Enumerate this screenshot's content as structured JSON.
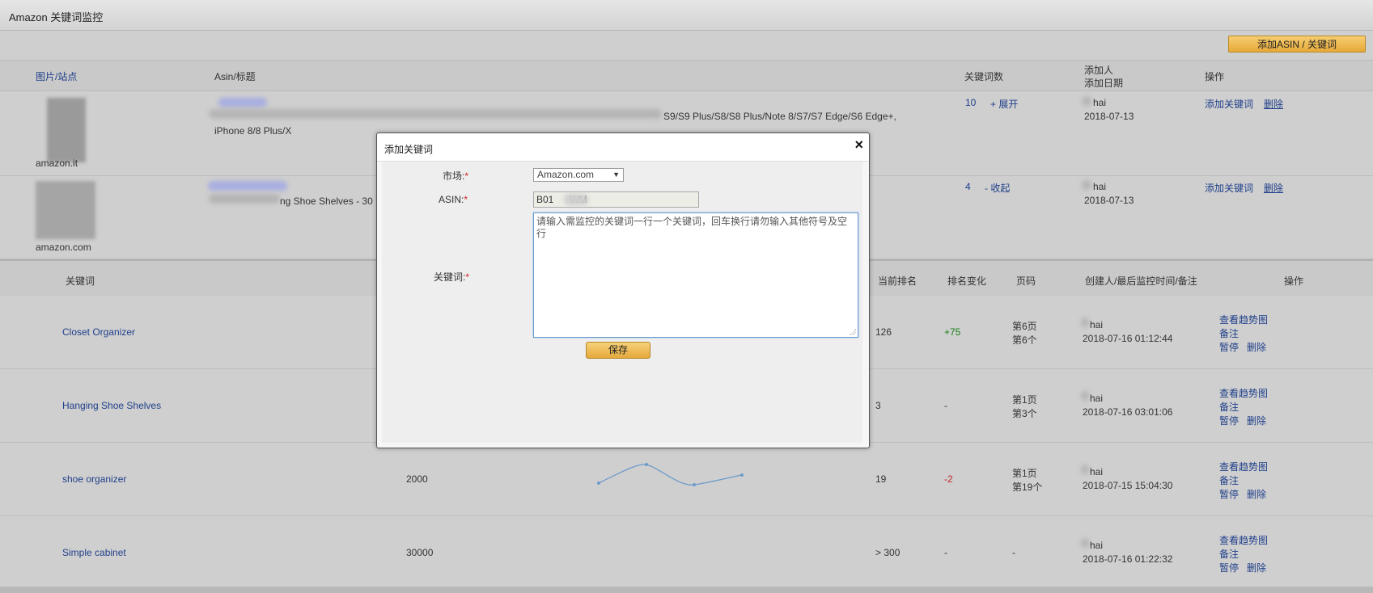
{
  "title": "Amazon 关键词监控",
  "toolbar": {
    "add_button": "添加ASIN / 关键词"
  },
  "product_table": {
    "headers": {
      "image_site": "图片/站点",
      "asin_title": "Asin/标题",
      "keyword_count": "关键词数",
      "added_by": "添加人",
      "added_date": "添加日期",
      "actions": "操作"
    },
    "rows": [
      {
        "site": "amazon.it",
        "title_end": "S9/S9 Plus/S8/S8 Plus/Note 8/S7/S7 Edge/S6 Edge+,",
        "title_line2": "iPhone 8/8 Plus/X",
        "count": "10",
        "toggle": "+ 展开",
        "user": "hai",
        "date": "2018-07-13",
        "add_kw": "添加关键词",
        "delete": "删除"
      },
      {
        "site": "amazon.com",
        "title_end": "ng Shoe Shelves - 30",
        "count": "4",
        "toggle": "- 收起",
        "user": "hai",
        "date": "2018-07-13",
        "add_kw": "添加关键词",
        "delete": "删除"
      }
    ]
  },
  "keyword_table": {
    "headers": {
      "keyword": "关键词",
      "current_rank": "当前排名",
      "rank_change": "排名变化",
      "page": "页码",
      "creator": "创建人/最后监控时间/备注",
      "actions": "操作"
    },
    "rows": [
      {
        "keyword": "Closet Organizer",
        "volume": "",
        "rank": "126",
        "change": "+75",
        "change_color": "#1a7f1a",
        "page1": "第6页",
        "page2": "第6个",
        "user": "hai",
        "time": "2018-07-16 01:12:44",
        "a_trend": "查看趋势图",
        "a_note": "备注",
        "a_pause": "暂停",
        "a_delete": "删除"
      },
      {
        "keyword": "Hanging Shoe Shelves",
        "volume": "",
        "rank": "3",
        "change": "-",
        "change_color": "#333333",
        "page1": "第1页",
        "page2": "第3个",
        "user": "hai",
        "time": "2018-07-16 03:01:06",
        "a_trend": "查看趋势图",
        "a_note": "备注",
        "a_pause": "暂停",
        "a_delete": "删除"
      },
      {
        "keyword": "shoe organizer",
        "volume": "2000",
        "rank": "19",
        "change": "-2",
        "change_color": "#c0262c",
        "page1": "第1页",
        "page2": "第19个",
        "user": "hai",
        "time": "2018-07-15 15:04:30",
        "a_trend": "查看趋势图",
        "a_note": "备注",
        "a_pause": "暂停",
        "a_delete": "删除"
      },
      {
        "keyword": "Simple cabinet",
        "volume": "30000",
        "rank": "> 300",
        "change": "-",
        "change_color": "#333333",
        "page1": "-",
        "page2": "",
        "user": "hai",
        "time": "2018-07-16 01:22:32",
        "a_trend": "查看趋势图",
        "a_note": "备注",
        "a_pause": "暂停",
        "a_delete": "删除"
      }
    ]
  },
  "modal": {
    "title": "添加关键词",
    "close": "×",
    "market_label": "市场:",
    "market_value": "Amazon.com",
    "asin_label": "ASIN:",
    "asin_value": "B01      WM",
    "keyword_label": "关键词:",
    "keyword_placeholder": "请输入需监控的关键词一行一个关键词，回车换行请勿输入其他符号及空行",
    "required_mark": "*",
    "save": "保存"
  },
  "colors": {
    "link": "#1f3f8a",
    "positive": "#1a7f1a",
    "negative": "#c0262c",
    "button": "#f0b94f"
  }
}
